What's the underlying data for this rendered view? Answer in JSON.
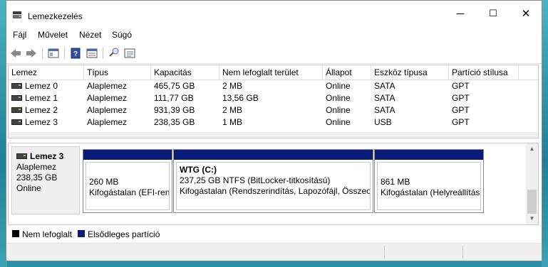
{
  "window": {
    "title": "Lemezkezelés",
    "controls": [
      "─",
      "☐",
      "✕"
    ]
  },
  "menu": [
    "Fájl",
    "Művelet",
    "Nézet",
    "Súgó"
  ],
  "toolbar_icons": [
    "back-arrow-icon",
    "forward-arrow-icon",
    "console-tree-icon",
    "help-icon",
    "properties-icon",
    "connect-icon",
    "settings-list-icon"
  ],
  "volume_list": {
    "columns": [
      "Lemez",
      "Típus",
      "Kapacitás",
      "Nem lefoglalt terület",
      "Állapot",
      "Eszköz típusa",
      "Partíció stílusa"
    ],
    "rows": [
      [
        "Lemez 0",
        "Alaplemez",
        "465,75 GB",
        "2 MB",
        "Online",
        "SATA",
        "GPT"
      ],
      [
        "Lemez 1",
        "Alaplemez",
        "111,77 GB",
        "13,56 GB",
        "Online",
        "SATA",
        "GPT"
      ],
      [
        "Lemez 2",
        "Alaplemez",
        "931,39 GB",
        "2 MB",
        "Online",
        "SATA",
        "GPT"
      ],
      [
        "Lemez 3",
        "Alaplemez",
        "238,35 GB",
        "1 MB",
        "Online",
        "USB",
        "GPT"
      ]
    ]
  },
  "disk_view": {
    "disk": {
      "name": "Lemez 3",
      "type": "Alaplemez",
      "size": "238,35 GB",
      "status": "Online"
    },
    "partitions": [
      {
        "title": "",
        "line1": "260 MB",
        "line2": "Kifogástalan (EFI-ren"
      },
      {
        "title": "WTG  (C:)",
        "line1": "237,25 GB NTFS (BitLocker-titkosítású)",
        "line2": "Kifogástalan (Rendszerindítás, Lapozófájl, Összeom"
      },
      {
        "title": "",
        "line1": "861 MB",
        "line2": "Kifogástalan (Helyreállítási"
      }
    ]
  },
  "legend": [
    {
      "label": "Nem lefoglalt",
      "color": "#000000"
    },
    {
      "label": "Elsődleges partíció",
      "color": "#0b1b7a"
    }
  ]
}
